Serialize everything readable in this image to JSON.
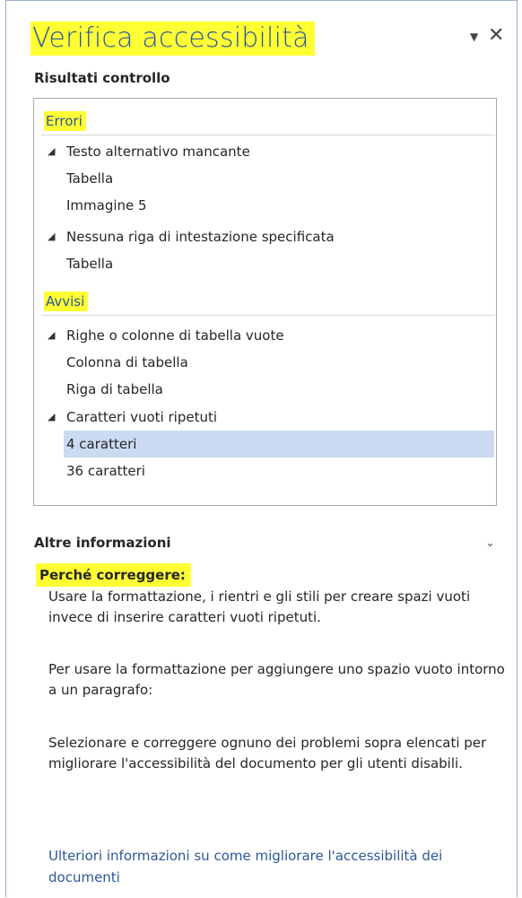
{
  "pane": {
    "title": "Verifica accessibilità",
    "dropdown_icon": "▼",
    "close_icon": "✕",
    "subtitle": "Risultati controllo"
  },
  "results": {
    "errors_label": "Errori",
    "errors": [
      {
        "group": "Testo alternativo mancante",
        "items": [
          "Tabella",
          "Immagine 5"
        ]
      },
      {
        "group": "Nessuna riga di intestazione specificata",
        "items": [
          "Tabella"
        ]
      }
    ],
    "warnings_label": "Avvisi",
    "warnings": [
      {
        "group": "Righe o colonne di tabella vuote",
        "items": [
          "Colonna di tabella",
          "Riga di tabella"
        ]
      },
      {
        "group": "Caratteri vuoti ripetuti",
        "items": [
          "4 caratteri",
          "36 caratteri"
        ]
      }
    ],
    "selected_item": "4 caratteri",
    "expand_glyph": "◢"
  },
  "info": {
    "header": "Altre informazioni",
    "chevron": "⌄",
    "why_label": "Perché correggere:",
    "para1": "Usare la formattazione, i rientri e gli stili per creare spazi vuoti invece di inserire caratteri vuoti ripetuti.",
    "para2": "Per usare la formattazione per aggiungere uno spazio vuoto intorno a un paragrafo:",
    "para3": "Selezionare e correggere ognuno dei problemi sopra elencati per migliorare l'accessibilità del documento per gli utenti disabili.",
    "link": "Ulteriori informazioni su come migliorare l'accessibilità dei documenti"
  },
  "colors": {
    "accent": "#2b579a",
    "highlight": "#ffff33",
    "selection": "#cbdaf1"
  }
}
